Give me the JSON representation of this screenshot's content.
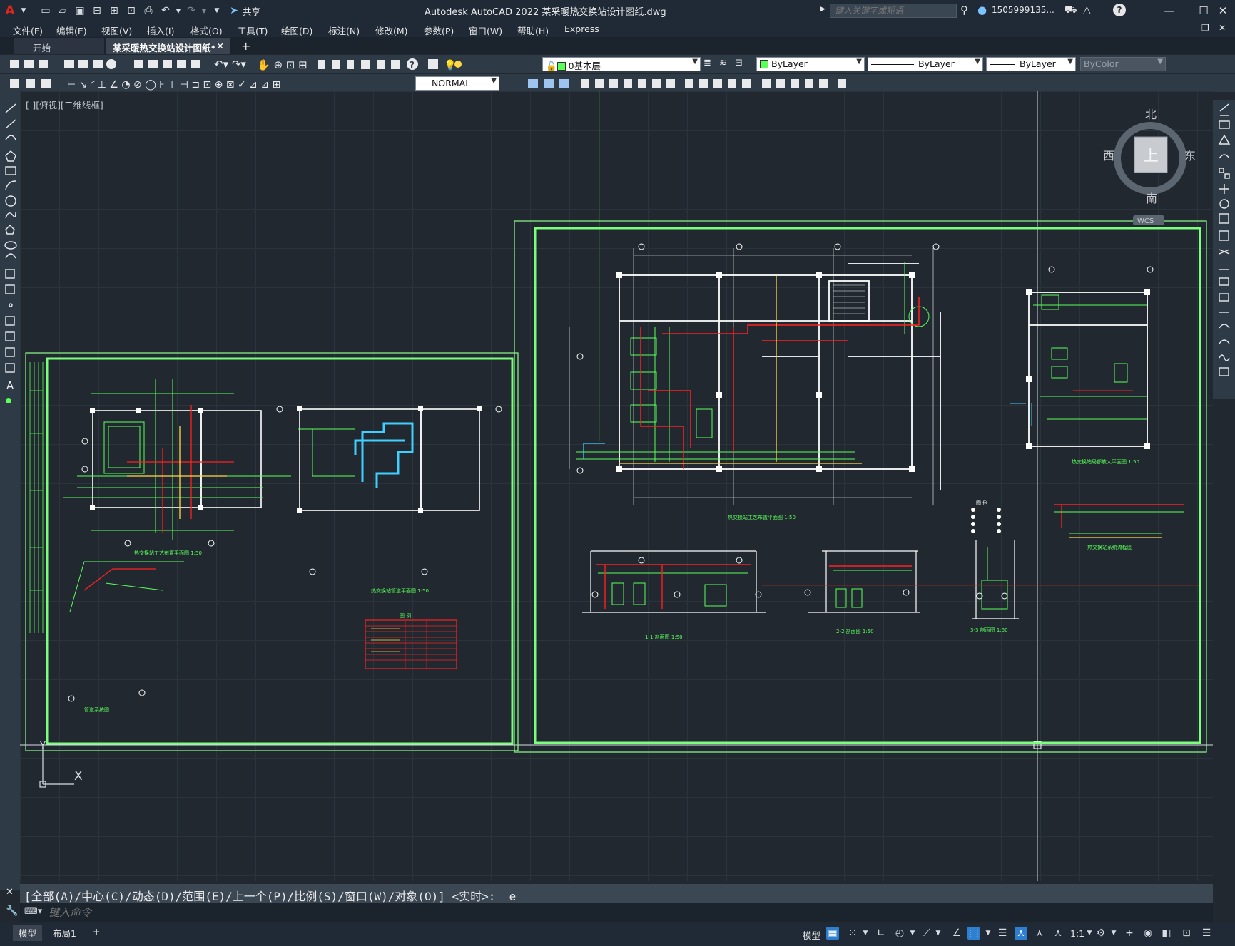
{
  "titlebar": {
    "app_title": "Autodesk AutoCAD 2022    某采暖热交换站设计图纸.dwg",
    "share_label": "共享",
    "search_placeholder": "键入关键字或短语",
    "user": "1505999135..."
  },
  "menu": [
    "文件(F)",
    "编辑(E)",
    "视图(V)",
    "插入(I)",
    "格式(O)",
    "工具(T)",
    "绘图(D)",
    "标注(N)",
    "修改(M)",
    "参数(P)",
    "窗口(W)",
    "帮助(H)",
    "Express"
  ],
  "tabs": {
    "start": "开始",
    "document": "某采暖热交换站设计图纸*",
    "new_tab": "+"
  },
  "toolbar": {
    "layer": "0基本层",
    "color": "ByLayer",
    "linetype": "ByLayer",
    "lineweight": "ByLayer",
    "plotstyle": "ByColor",
    "dimstyle": "NORMAL"
  },
  "viewport": {
    "label": "[-][俯视][二维线框]"
  },
  "viewcube": {
    "north": "北",
    "south": "南",
    "east": "东",
    "west": "西",
    "face": "上",
    "wcs": "WCS"
  },
  "ucs": {
    "x": "X",
    "y": "Y"
  },
  "drawing": {
    "left_sheet": {
      "title_plan": "热交换站工艺布置平面图 1:50",
      "title_piping": "热交换站管道平面图 1:50",
      "title_axon": "管道系统图",
      "legend_title": "图 例"
    },
    "right_sheet": {
      "title_plan": "热交换站工艺布置平面图 1:50",
      "title_section1": "1-1 剖面图 1:50",
      "title_section2": "2-2 剖面图 1:50",
      "title_section3": "3-3 剖面图 1:50",
      "title_plan2": "热交换站局部放大平面图 1:50",
      "title_system": "热交换站系统流程图",
      "legend_title": "图 例"
    }
  },
  "command": {
    "history": "[全部(A)/中心(C)/动态(D)/范围(E)/上一个(P)/比例(S)/窗口(W)/对象(O)] <实时>: _e",
    "placeholder": "键入命令"
  },
  "statusbar": {
    "model_tab": "模型",
    "layout_tab": "布局1",
    "add_tab": "+",
    "space_label": "模型",
    "scale": "1:1"
  },
  "colors": {
    "accent": "#2f7fd0",
    "drawing_green": "#5aff5a",
    "drawing_red": "#ff2020",
    "drawing_white": "#ffffff"
  }
}
